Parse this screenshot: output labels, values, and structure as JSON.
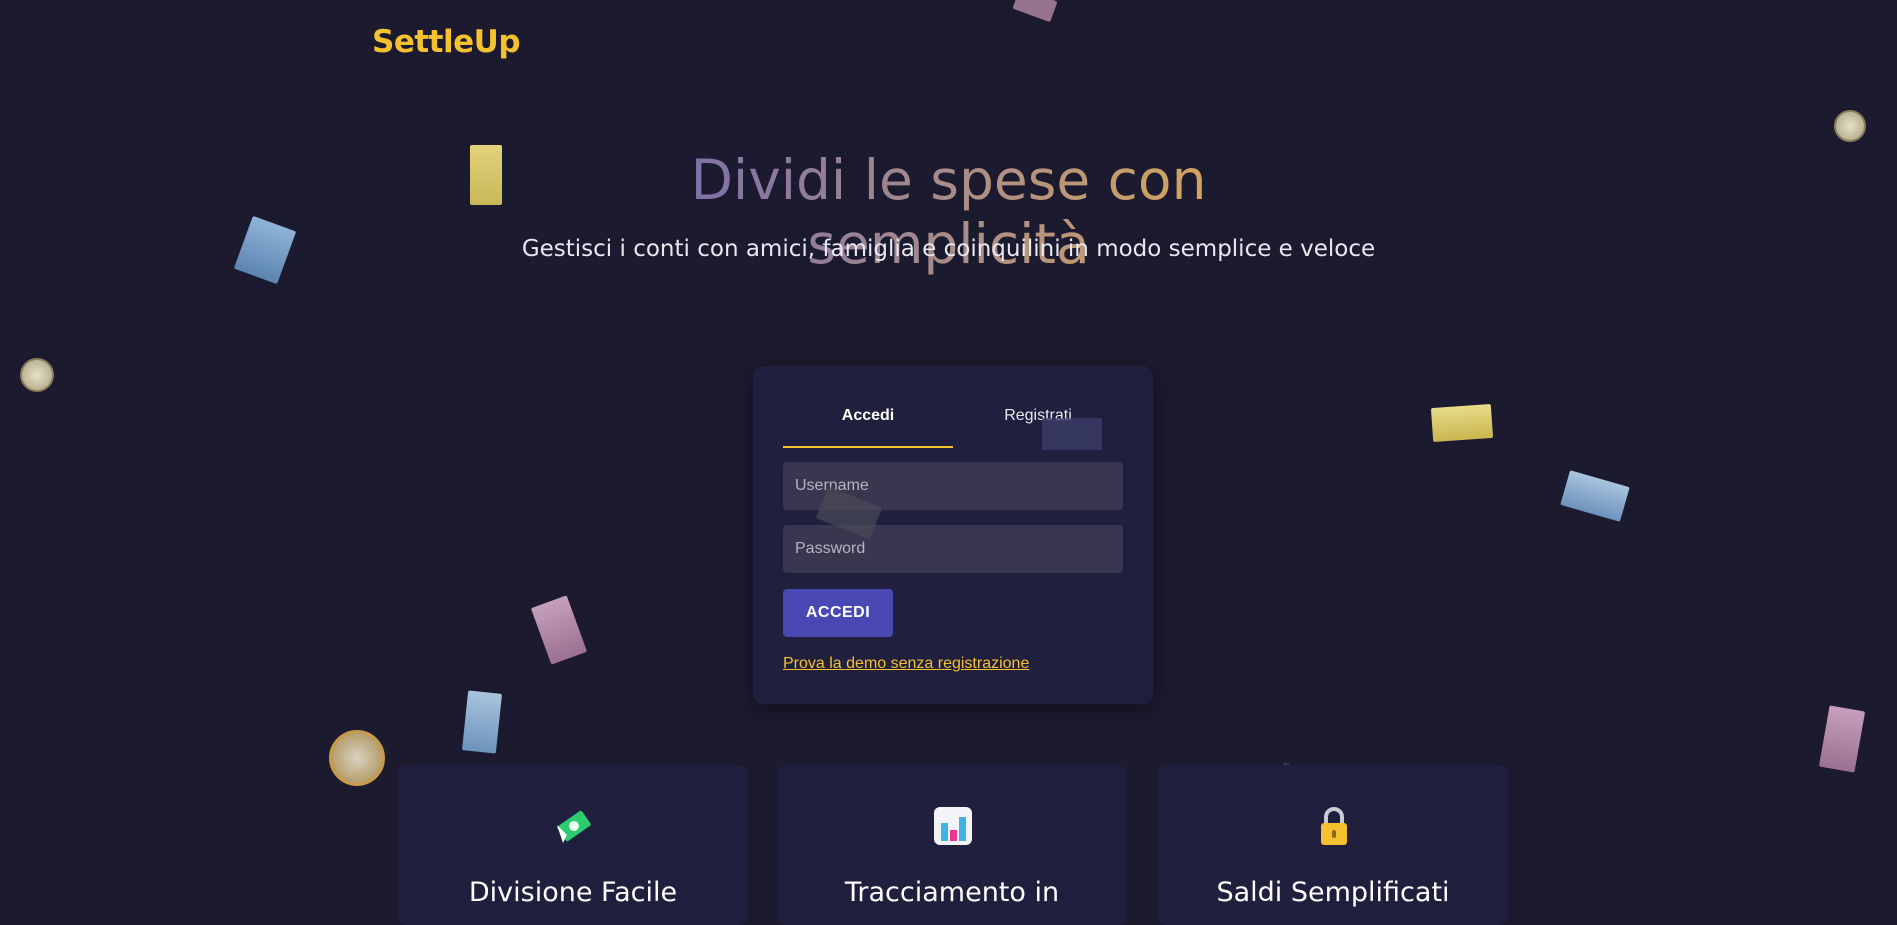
{
  "app": {
    "logo": "SettleUp"
  },
  "hero": {
    "title": "Dividi le spese con semplicità",
    "subtitle": "Gestisci i conti con amici, famiglia e coinquilini in modo semplice e veloce"
  },
  "auth": {
    "tabs": [
      {
        "label": "Accedi",
        "active": true
      },
      {
        "label": "Registrati",
        "active": false
      }
    ],
    "username_placeholder": "Username",
    "password_placeholder": "Password",
    "submit_label": "ACCEDI",
    "demo_link": "Prova la demo senza registrazione"
  },
  "features": [
    {
      "title": "Divisione Facile",
      "icon": "money-icon"
    },
    {
      "title": "Tracciamento in",
      "icon": "bar-chart-icon"
    },
    {
      "title": "Saldi Semplificati",
      "icon": "lock-icon"
    }
  ],
  "colors": {
    "background": "#1b1a2e",
    "accent": "#f5c12e",
    "card": "#201f3e",
    "button": "#4a49b3"
  }
}
